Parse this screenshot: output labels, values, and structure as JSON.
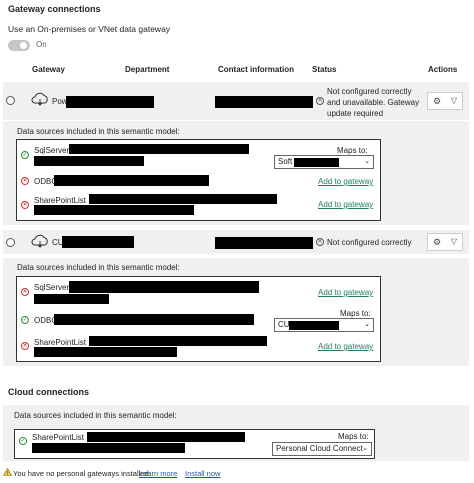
{
  "gateway": {
    "heading": "Gateway connections",
    "toggle_label": "Use an On-premises or VNet data gateway",
    "toggle_state": "On",
    "columns": [
      "Gateway",
      "Department",
      "Contact information",
      "Status",
      "Actions"
    ],
    "rows": [
      {
        "name_prefix": "Pow",
        "status": "Not configured correctly and unavailable. Gateway update required",
        "status_lines": [
          "Not configured correctly",
          "and unavailable. Gateway",
          "update required"
        ],
        "sources_label": "Data sources included in this semantic model:",
        "sources": [
          {
            "name": "SqlServer",
            "state": "ok",
            "maps_to_label": "Maps to:",
            "select_value": "Soft"
          },
          {
            "name": "ODBC",
            "state": "error",
            "action": "Add to gateway"
          },
          {
            "name": "SharePointList",
            "state": "error",
            "action": "Add to gateway"
          }
        ]
      },
      {
        "name_prefix": "CU",
        "status": "Not configured correctly",
        "sources_label": "Data sources included in this semantic model:",
        "sources": [
          {
            "name": "SqlServer",
            "state": "error",
            "action": "Add to gateway"
          },
          {
            "name": "ODBC",
            "state": "ok",
            "maps_to_label": "Maps to:",
            "select_value": "CU"
          },
          {
            "name": "SharePointList",
            "state": "error",
            "action": "Add to gateway"
          }
        ]
      }
    ]
  },
  "cloud": {
    "heading": "Cloud connections",
    "sources_label": "Data sources included in this semantic model:",
    "source_name": "SharePointList",
    "maps_to_label": "Maps to:",
    "select_value": "Personal Cloud Connect"
  },
  "footer": {
    "warning_text": "You have no personal gateways installed.",
    "learn_more": "Learn more",
    "install_now": "Install now"
  },
  "colors": {
    "panel_bg": "#f0f0f0",
    "ok_green": "#2e8b3a",
    "error_red": "#c43c3c",
    "link_teal": "#1a7f64",
    "link_blue": "#1f5aa6"
  },
  "icons": [
    "cloud-gateway-icon",
    "status-ok-icon",
    "status-error-icon",
    "gear-icon",
    "chevron-down-icon",
    "warning-icon"
  ]
}
